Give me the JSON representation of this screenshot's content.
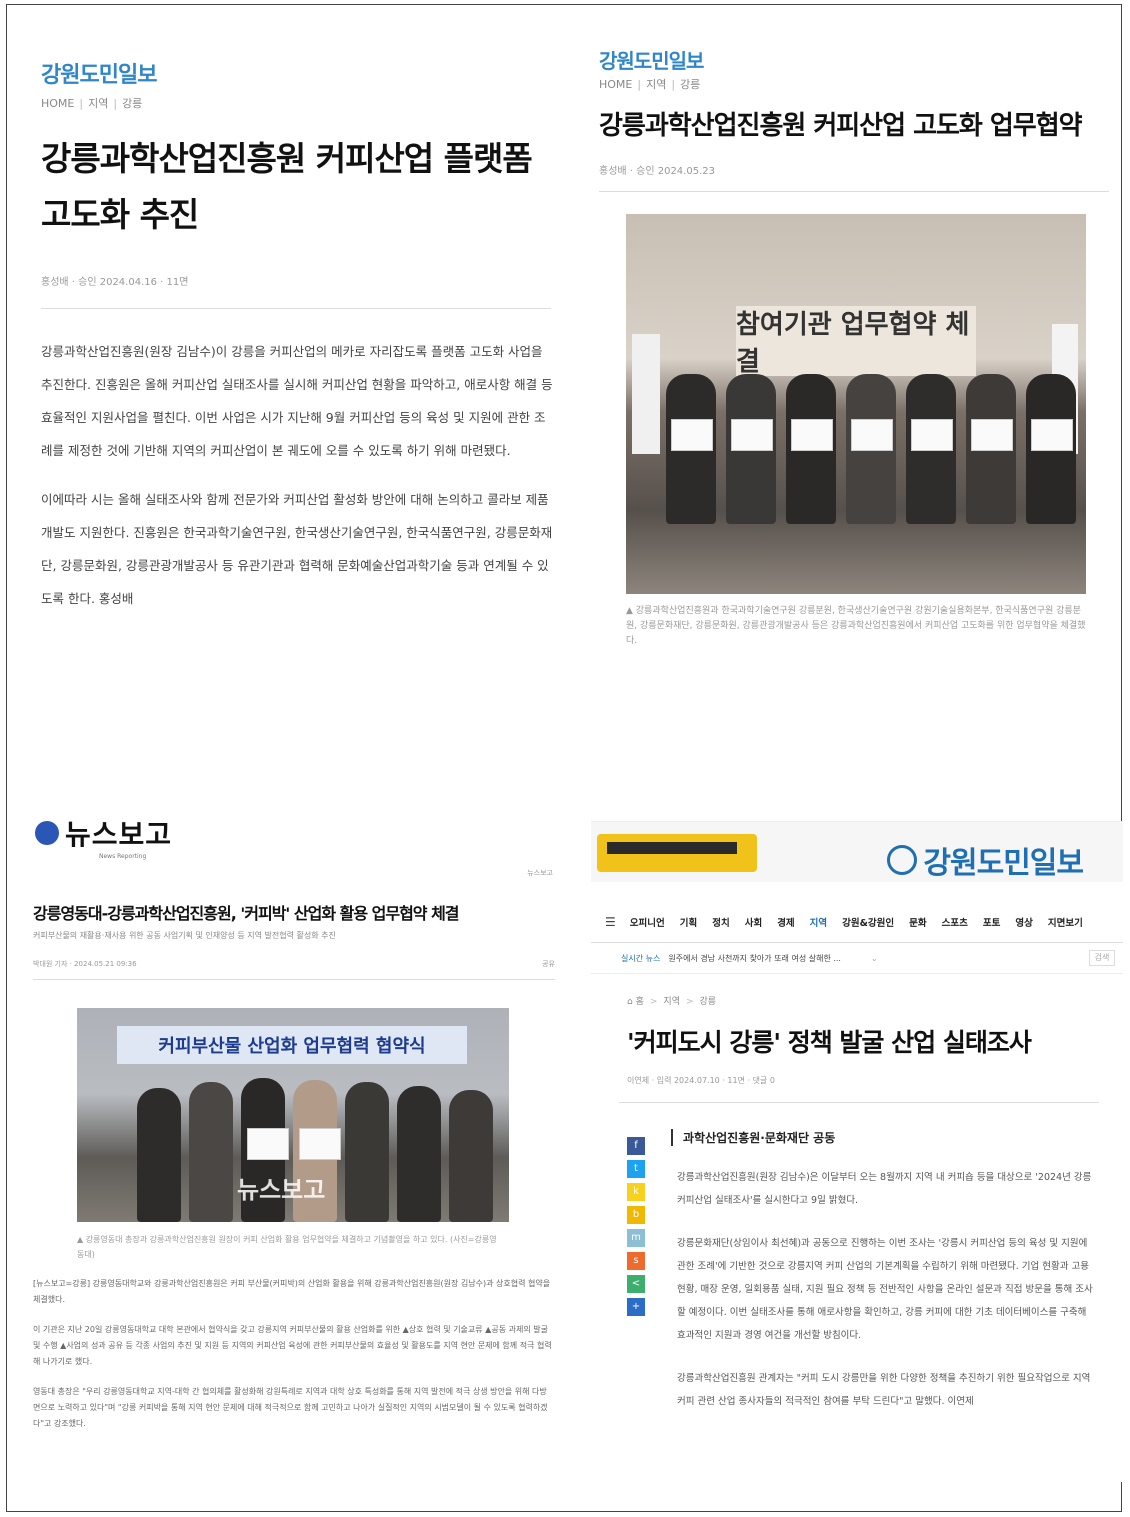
{
  "colors": {
    "brand_blue": "#2f86c8",
    "gangwon_blue": "#1e6fb3",
    "newsbogo_blue": "#2a56b5"
  },
  "p1": {
    "logo": "강원도민일보",
    "breadcrumb": [
      "HOME",
      "지역",
      "강릉"
    ],
    "title": "강릉과학산업진흥원 커피산업 플랫폼 고도화 추진",
    "meta": "홍성배 · 승인 2024.04.16 · 11면",
    "paragraphs": [
      "강릉과학산업진흥원(원장 김남수)이 강릉을 커피산업의 메카로 자리잡도록 플랫폼 고도화 사업을 추진한다. 진흥원은 올해 커피산업 실태조사를 실시해 커피산업 현황을 파악하고, 애로사항 해결 등 효율적인 지원사업을 펼친다. 이번 사업은 시가 지난해 9월 커피산업 등의 육성 및 지원에 관한 조례를 제정한 것에 기반해 지역의 커피산업이 본 궤도에 오를 수 있도록 하기 위해 마련됐다.",
      "이에따라 시는 올해 실태조사와 함께 전문가와 커피산업 활성화 방안에 대해 논의하고 콜라보 제품 개발도 지원한다. 진흥원은 한국과학기술연구원, 한국생산기술연구원, 한국식품연구원, 강릉문화재단, 강릉문화원, 강릉관광개발공사 등 유관기관과 협력해 문화예술산업과학기술 등과 연계될 수 있도록 한다. 홍성배"
    ]
  },
  "p2": {
    "logo": "강원도민일보",
    "breadcrumb": [
      "HOME",
      "지역",
      "강릉"
    ],
    "title": "강릉과학산업진흥원 커피산업 고도화 업무협약",
    "meta": "홍성배 · 승인 2024.05.23",
    "photo_banner": "참여기관 업무협약 체결",
    "caption": "▲ 강릉과학산업진흥원과 한국과학기술연구원 강릉분원, 한국생산기술연구원 강원기술실용화본부, 한국식품연구원 강릉분원, 강릉문화재단, 강릉문화원, 강릉관광개발공사 등은 강릉과학산업진흥원에서 커피산업 고도화를 위한 업무협약을 체결했다."
  },
  "p3": {
    "logo": "뉴스보고",
    "logo_sub": "News Reporting",
    "section": "뉴스보고",
    "title": "강릉영동대-강릉과학산업진흥원, '커피박' 산업화 활용 업무협약 체결",
    "subtitle": "커피부산물의 재활용·재사용 위한 공동 사업기획 및 인재양성 등 지역 발전협력 활성화 추진",
    "meta": "박대원 기자 · 2024.05.21 09:36",
    "meta_right": "공유",
    "photo_banner": "커피부산물 산업화 업무협력 협약식",
    "watermark": "뉴스보고",
    "caption": "▲ 강릉영동대 총장과 강릉과학산업진흥원 원장이 커피 산업화 활용 업무협약을 체결하고 기념촬영을 하고 있다. (사진=강릉영동대)",
    "paragraphs": [
      "[뉴스보고=강릉] 강릉영동대학교와 강릉과학산업진흥원은 커피 부산물(커피박)의 산업화 활용을 위해 강릉과학산업진흥원(원장 김남수)과 상호협력 협약을 체결했다.",
      "이 기관은 지난 20일 강릉영동대학교 대학 본관에서 협약식을 갖고 강릉지역 커피부산물의 활용 산업화를 위한 ▲상호 협력 및 기술교류 ▲공동 과제의 발굴 및 수행 ▲사업의 성과 공유 등 각종 사업의 추진 및 지원 등 지역의 커피산업 육성에 관한 커피부산물의 효율성 및 활용도를 지역 현안 문제에 함께 적극 협력해 나가기로 했다.",
      "영동대 총장은 \"우리 강릉영동대학교 지역-대학 간 협의체를 활성화해 강원특례로 지역과 대학 상호 특성화를 통해 지역 발전에 적극 상생 방안을 위해 다방면으로 노력하고 있다\"며 \"강릉 커피박을 통해 지역 현안 문제에 대해 적극적으로 함께 고민하고 나아가 실질적인 지역의 시범모델이 될 수 있도록 협력하겠다\"고 강조했다."
    ]
  },
  "p4": {
    "logo": "강원도민일보",
    "nav": [
      "오피니언",
      "기획",
      "정치",
      "사회",
      "경제",
      "지역",
      "강원&강원인",
      "문화",
      "스포츠",
      "포토",
      "영상",
      "지면보기"
    ],
    "nav_active": "지역",
    "live_tag": "실시간 뉴스",
    "live_text": "원주에서 경남 사천까지 찾아가 또래 여성 살해한 ...",
    "search_box": "검색",
    "breadcrumb": [
      "홈",
      "지역",
      "강릉"
    ],
    "title": "'커피도시 강릉' 정책 발굴 산업 실태조사",
    "meta": "이연제 · 입력 2024.07.10 · 11면 · 댓글 0",
    "subheading": "과학산업진흥원·문화재단 공동",
    "social": [
      "f",
      "t",
      "k",
      "b",
      "m",
      "s",
      "<",
      "+"
    ],
    "paragraphs": [
      "강릉과학산업진흥원(원장 김남수)은 이달부터 오는 8월까지 지역 내 커피숍 등을 대상으로 '2024년 강릉커피산업 실태조사'를 실시한다고 9일 밝혔다.",
      "강릉문화재단(상임이사 최선혜)과 공동으로 진행하는 이번 조사는 '강릉시 커피산업 등의 육성 및 지원에 관한 조례'에 기반한 것으로 강릉지역 커피 산업의 기본계획을 수립하기 위해 마련됐다. 기업 현황과 고용 현황, 매장 운영, 일회용품 실태, 지원 필요 정책 등 전반적인 사항을 온라인 설문과 직접 방문을 통해 조사할 예정이다. 이번 실태조사를 통해 애로사항을 확인하고, 강릉 커피에 대한 기초 데이터베이스를 구축해 효과적인 지원과 경영 여건을 개선할 방침이다.",
      "강릉과학산업진흥원 관계자는 \"커피 도시 강릉만을 위한 다양한 정책을 추진하기 위한 필요작업으로 지역 커피 관련 산업 종사자들의 적극적인 참여를 부탁 드린다\"고 말했다. 이연제"
    ]
  }
}
